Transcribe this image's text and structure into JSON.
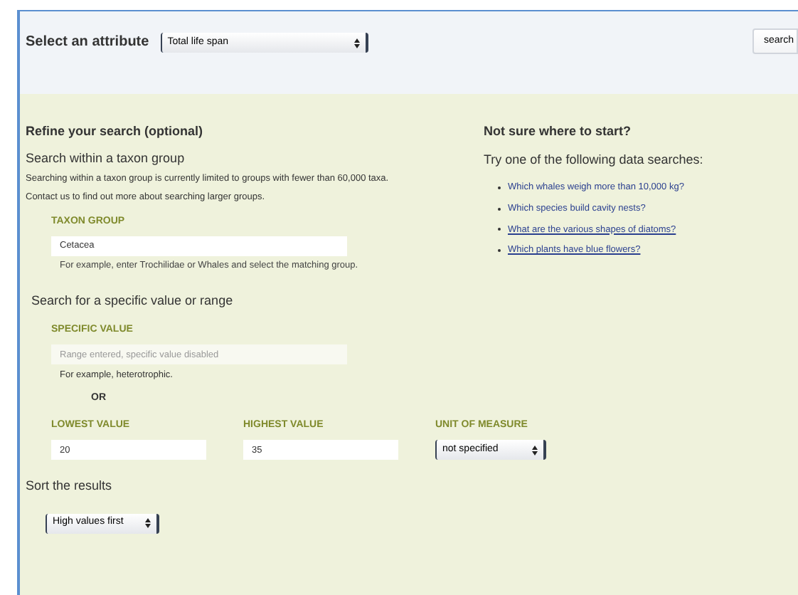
{
  "attribute_bar": {
    "label": "Select an attribute",
    "select": {
      "value": "Total life span"
    },
    "search_button": "search"
  },
  "refine": {
    "title": "Refine your search (optional)",
    "taxon": {
      "heading": "Search within a taxon group",
      "note": "Searching within a taxon group is currently limited to groups with fewer than 60,000 taxa. Contact us to find out more about searching larger groups.",
      "label": "TAXON GROUP",
      "value": "Cetacea",
      "hint": "For example, enter Trochilidae or Whales and select the matching group."
    },
    "value": {
      "heading": "Search for a specific value or range",
      "label": "SPECIFIC VALUE",
      "placeholder": "Range entered, specific value disabled",
      "disabled": true,
      "hint": "For example, heterotrophic.",
      "or": "OR",
      "fields": [
        {
          "label": "LOWEST VALUE",
          "kind": "input",
          "value": "20"
        },
        {
          "label": "HIGHEST VALUE",
          "kind": "input",
          "value": "35"
        },
        {
          "label": "UNIT OF MEASURE",
          "kind": "select",
          "value": "not specified"
        }
      ]
    },
    "sort": {
      "heading": "Sort the results",
      "value": "High values first"
    }
  },
  "suggestions": {
    "title": "Not sure where to start?",
    "intro": "Try one of the following data searches:",
    "links": [
      {
        "text": "Which whales weigh more than 10,000 kg?",
        "underlined": false
      },
      {
        "text": "Which species build cavity nests?",
        "underlined": false
      },
      {
        "text": "What are the various shapes of diatoms?",
        "underlined": true
      },
      {
        "text": "Which plants have blue flowers?",
        "underlined": true
      }
    ]
  }
}
